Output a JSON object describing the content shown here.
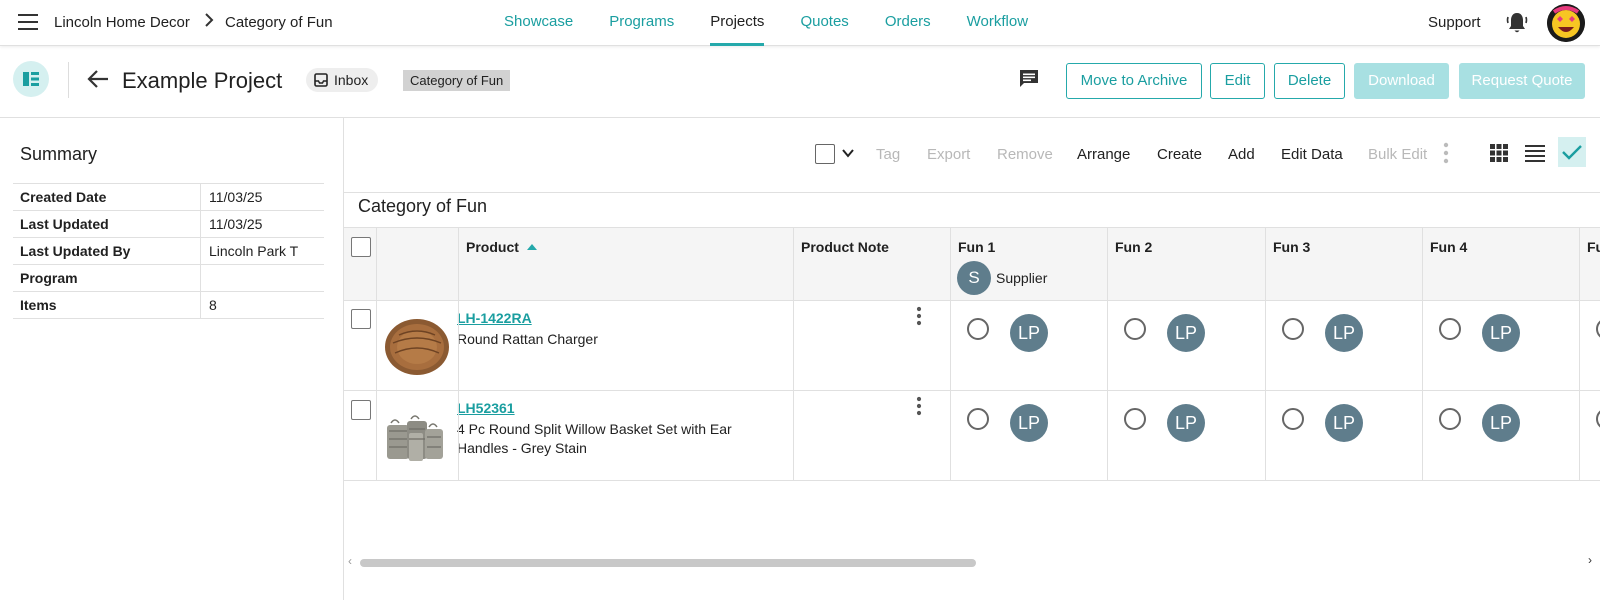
{
  "topbar": {
    "breadcrumb": [
      "Lincoln Home Decor",
      "Category of Fun"
    ],
    "tabs": [
      {
        "label": "Showcase",
        "active": false
      },
      {
        "label": "Programs",
        "active": false
      },
      {
        "label": "Projects",
        "active": true
      },
      {
        "label": "Quotes",
        "active": false
      },
      {
        "label": "Orders",
        "active": false
      },
      {
        "label": "Workflow",
        "active": false
      }
    ],
    "support_label": "Support"
  },
  "project": {
    "title": "Example Project",
    "inbox_label": "Inbox",
    "tag_label": "Category of Fun",
    "buttons": {
      "archive": "Move to Archive",
      "edit": "Edit",
      "delete": "Delete",
      "download": "Download",
      "request_quote": "Request Quote"
    }
  },
  "summary": {
    "title": "Summary",
    "rows": [
      {
        "key": "Created Date",
        "value": "11/03/25"
      },
      {
        "key": "Last Updated",
        "value": "11/03/25"
      },
      {
        "key": "Last Updated By",
        "value": "Lincoln Park T"
      },
      {
        "key": "Program",
        "value": ""
      },
      {
        "key": "Items",
        "value": "8"
      }
    ]
  },
  "toolbar": {
    "tag": "Tag",
    "export": "Export",
    "remove": "Remove",
    "arrange": "Arrange",
    "create": "Create",
    "add": "Add",
    "edit_data": "Edit Data",
    "bulk_edit": "Bulk Edit"
  },
  "table": {
    "category_title": "Category of Fun",
    "headers": {
      "product": "Product",
      "note": "Product Note",
      "fun1": "Fun 1",
      "fun2": "Fun 2",
      "fun3": "Fun 3",
      "fun4": "Fun 4",
      "fun5": "Fu"
    },
    "supplier_badge": "S",
    "supplier_label": "Supplier",
    "assignee_initials": "LP",
    "rows": [
      {
        "sku": "LH-1422RA",
        "name": "Round Rattan Charger"
      },
      {
        "sku": "LH52361",
        "name": "4 Pc Round Split Willow Basket Set with Ear Handles - Grey Stain"
      }
    ]
  },
  "colors": {
    "accent": "#25a9ab",
    "accent_text": "#1a9ea0",
    "disabled_button": "#a8e0e2",
    "badge": "#5f7d8c"
  }
}
